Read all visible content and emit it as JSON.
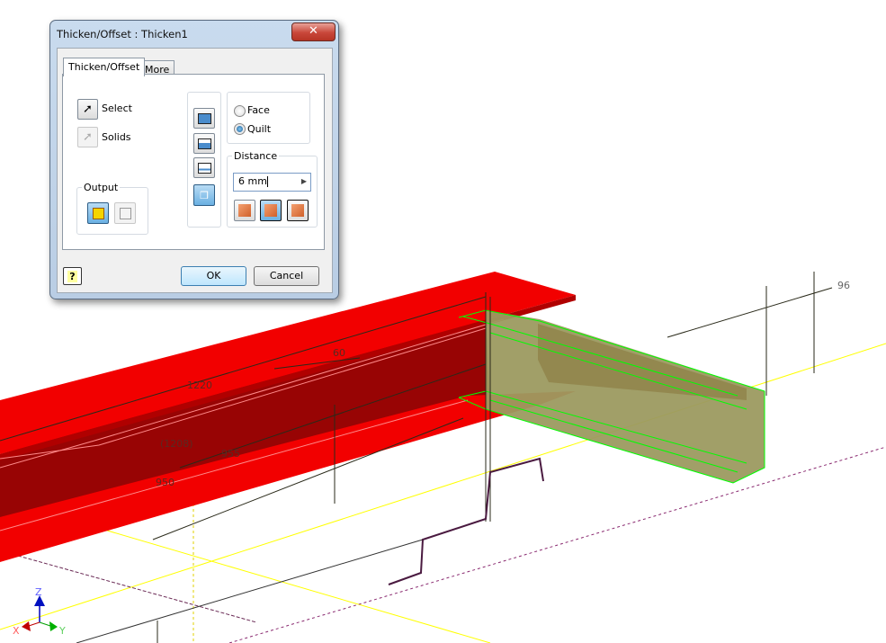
{
  "dialog": {
    "title": "Thicken/Offset : Thicken1",
    "close_icon": "close-icon",
    "tabs": [
      {
        "label": "Thicken/Offset",
        "active": true
      },
      {
        "label": "More",
        "active": false
      }
    ],
    "select_label": "Select",
    "solids_label": "Solids",
    "output_label": "Output",
    "output_buttons": [
      {
        "icon": "solid-output-icon",
        "active": true
      },
      {
        "icon": "surface-output-icon",
        "active": false
      }
    ],
    "mode_buttons": [
      "quilt-mode-1-icon",
      "quilt-mode-2-icon",
      "quilt-mode-3-icon",
      "automatic-blending-icon"
    ],
    "face_label": "Face",
    "quilt_label": "Quilt",
    "selected_mode": "Quilt",
    "distance_label": "Distance",
    "distance_value": "6 mm",
    "direction_buttons": [
      {
        "icon": "direction-1-icon",
        "active": false
      },
      {
        "icon": "direction-2-icon",
        "active": true
      },
      {
        "icon": "symmetric-icon",
        "active": false
      }
    ],
    "ok_label": "OK",
    "cancel_label": "Cancel",
    "help_icon": "help-icon"
  },
  "viewport": {
    "dimensions": [
      "1220",
      "60",
      "(1208)",
      "955",
      "950",
      "96"
    ],
    "axes": {
      "x": "X",
      "y": "Y",
      "z": "Z"
    },
    "colors": {
      "beam": "#f00000",
      "beam_web": "#980404",
      "channel": "#9c9a60",
      "selection": "#00ff00",
      "axis_line": "#ffff00"
    }
  }
}
